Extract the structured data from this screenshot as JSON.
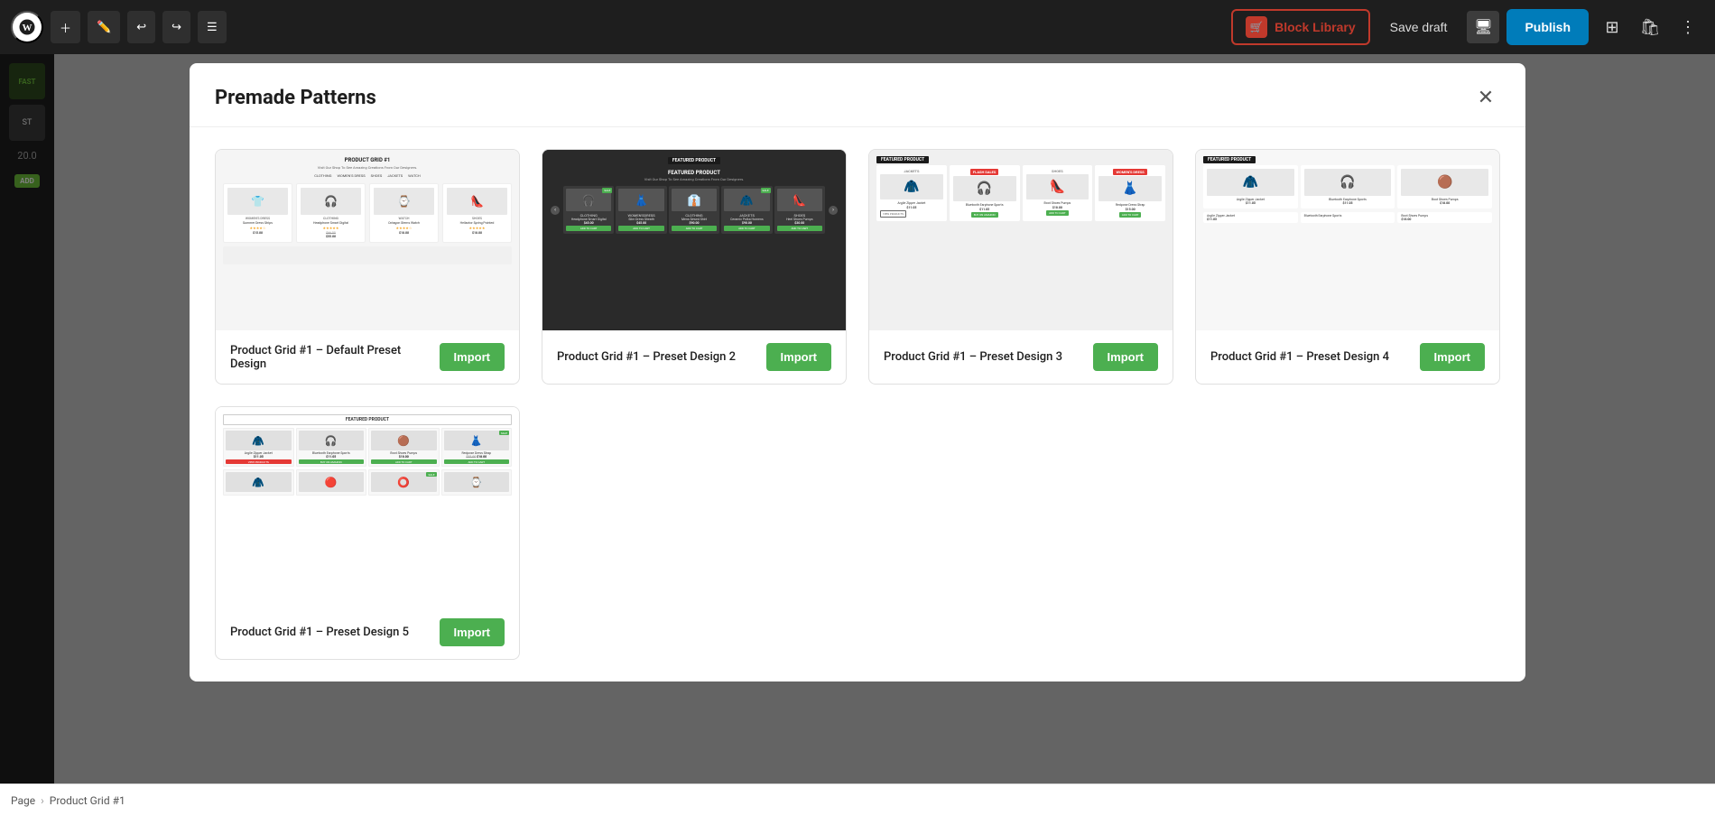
{
  "toolbar": {
    "wp_logo": "W",
    "add_label": "+",
    "undo_label": "↩",
    "redo_label": "↪",
    "list_view_label": "☰",
    "block_library_label": "Block Library",
    "save_draft_label": "Save draft",
    "publish_label": "Publish"
  },
  "modal": {
    "title": "Premade Patterns",
    "close_label": "×",
    "patterns": [
      {
        "id": "pattern-1",
        "name": "Product Grid #1 – Default Preset Design",
        "import_label": "Import",
        "theme": "light",
        "badge": "",
        "header": "PRODUCT GRID #1",
        "subtitle": "Visit Our Shop To See Amazing Creations From Our Designers."
      },
      {
        "id": "pattern-2",
        "name": "Product Grid #1 – Preset Design 2",
        "import_label": "Import",
        "theme": "dark",
        "badge": "FEATURED PRODUCT",
        "header": "FEATURED PRODUCT",
        "subtitle": "Visit Our Shop To See Amazing Creations From Our Designers."
      },
      {
        "id": "pattern-3",
        "name": "Product Grid #1 – Preset Design 3",
        "import_label": "Import",
        "theme": "light-gray",
        "badge": "FEATURED PRODUCT",
        "header": "",
        "subtitle": ""
      },
      {
        "id": "pattern-4",
        "name": "Product Grid #1 – Preset Design 4",
        "import_label": "Import",
        "theme": "white",
        "badge": "FEATURED PRODUCT",
        "header": "",
        "subtitle": ""
      },
      {
        "id": "pattern-5",
        "name": "Product Grid #1 – Preset Design 5",
        "import_label": "Import",
        "theme": "white",
        "badge": "FEATURED PRODUCT",
        "header": "",
        "subtitle": ""
      }
    ],
    "products": [
      {
        "name": "Summer Dress Stripe",
        "price": "$15.00",
        "icon": "👕",
        "category": "WOMEN'S DRESS"
      },
      {
        "name": "Headphone Smart Digital",
        "price": "$55.00",
        "old_price": "$66.00",
        "icon": "🎧",
        "category": "CLOTHING"
      },
      {
        "name": "Octagon Stems Watch",
        "price": "$18.00",
        "icon": "⌚",
        "category": "WATCH"
      },
      {
        "name": "Hellactor Spring Pointed",
        "price": "$18.00",
        "icon": "👠",
        "category": "SHOES"
      },
      {
        "name": "Argile Zipper Jacket",
        "price": "$11.05",
        "icon": "🧥",
        "category": "JACKETS"
      },
      {
        "name": "Bluetooth Earphone Sports",
        "price": "$11.05",
        "icon": "🎧",
        "category": ""
      },
      {
        "name": "Boot Shoes Pumps",
        "price": "$18.00",
        "icon": "👠",
        "category": ""
      },
      {
        "name": "Redpose Dress Strap",
        "price": "$15.00",
        "icon": "👗",
        "category": ""
      }
    ]
  },
  "bottom_bar": {
    "page_label": "Page",
    "sep": "›",
    "product_grid_label": "Product Grid #1"
  },
  "sidebar": {
    "fast_label": "FAST",
    "item1": "ST",
    "price": "20.0",
    "add_label": "ADD"
  }
}
